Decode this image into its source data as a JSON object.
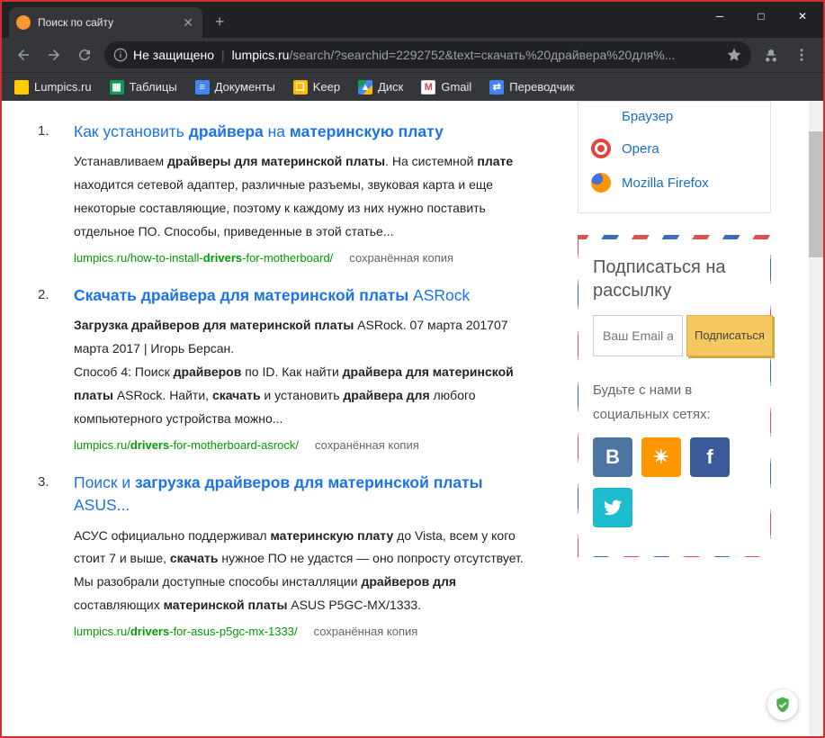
{
  "window": {
    "tab_title": "Поиск по сайту",
    "addr_security": "Не защищено",
    "addr_domain": "lumpics.ru",
    "addr_path": "/search/?searchid=2292752&text=скачать%20драйвера%20для%..."
  },
  "bookmarks": [
    {
      "label": "Lumpics.ru",
      "color": "#ffcc00"
    },
    {
      "label": "Таблицы",
      "color": "#0f9d58"
    },
    {
      "label": "Документы",
      "color": "#4285f4"
    },
    {
      "label": "Keep",
      "color": "#ffbb00"
    },
    {
      "label": "Диск",
      "color": "#0f9d58"
    },
    {
      "label": "Gmail",
      "color": "#ffffff"
    },
    {
      "label": "Переводчик",
      "color": "#4285f4"
    }
  ],
  "results": [
    {
      "num": "1.",
      "title_html": "Как установить <b>драйвера</b> на <b>материнскую плату</b>",
      "snippet_html": "Устанавливаем <b>драйверы для материнской платы</b>. На системной <b>плате</b> находится сетевой адаптер, различные разъемы, звуковая карта и еще некоторые составляющие, поэтому к каждому из них нужно поставить отдельное ПО. Способы, приведенные в этой статье...",
      "url_html": "lumpics.ru/how-to-install-<b>drivers</b>-for-motherboard/",
      "cached": "сохранённая копия"
    },
    {
      "num": "2.",
      "title_html": "<b>Скачать драйвера для материнской платы</b> ASRock",
      "snippet_html": "<b>Загрузка драйверов для материнской платы</b> ASRock. 07 марта 201707 марта 2017 | Игорь Берсан.<br>Способ 4: Поиск <b>драйверов</b> по ID. Как найти <b>драйвера для материнской платы</b> ASRock. Найти, <b>скачать</b> и установить <b>драйвера для</b> любого компьютерного устройства можно...",
      "url_html": "lumpics.ru/<b>drivers</b>-for-motherboard-asrock/",
      "cached": "сохранённая копия"
    },
    {
      "num": "3.",
      "title_html": "Поиск и <b>загрузка драйверов для материнской платы</b> ASUS...",
      "snippet_html": "АСУС официально поддерживал <b>материнскую плату</b> до Vista, всем у кого стоит 7 и выше, <b>скачать</b> нужное ПО не удастся — оно попросту отсутствует.<br>Мы разобрали доступные способы инсталляции <b>драйверов для</b> составляющих <b>материнской платы</b> ASUS P5GC-MX/1333.",
      "url_html": "lumpics.ru/<b>drivers</b>-for-asus-p5gc-mx-1333/",
      "cached": "сохранённая копия"
    }
  ],
  "sidebar": {
    "browser_top": "Браузер",
    "browsers": [
      {
        "label": "Opera",
        "color": "#e8413a"
      },
      {
        "label": "Mozilla Firefox",
        "color": "#ff9500"
      }
    ],
    "subscribe_title": "Подписаться на рассылку",
    "email_placeholder": "Ваш Email a",
    "subscribe_btn": "Подписаться",
    "social_label": "Будьте с нами в социальных сетях:"
  }
}
